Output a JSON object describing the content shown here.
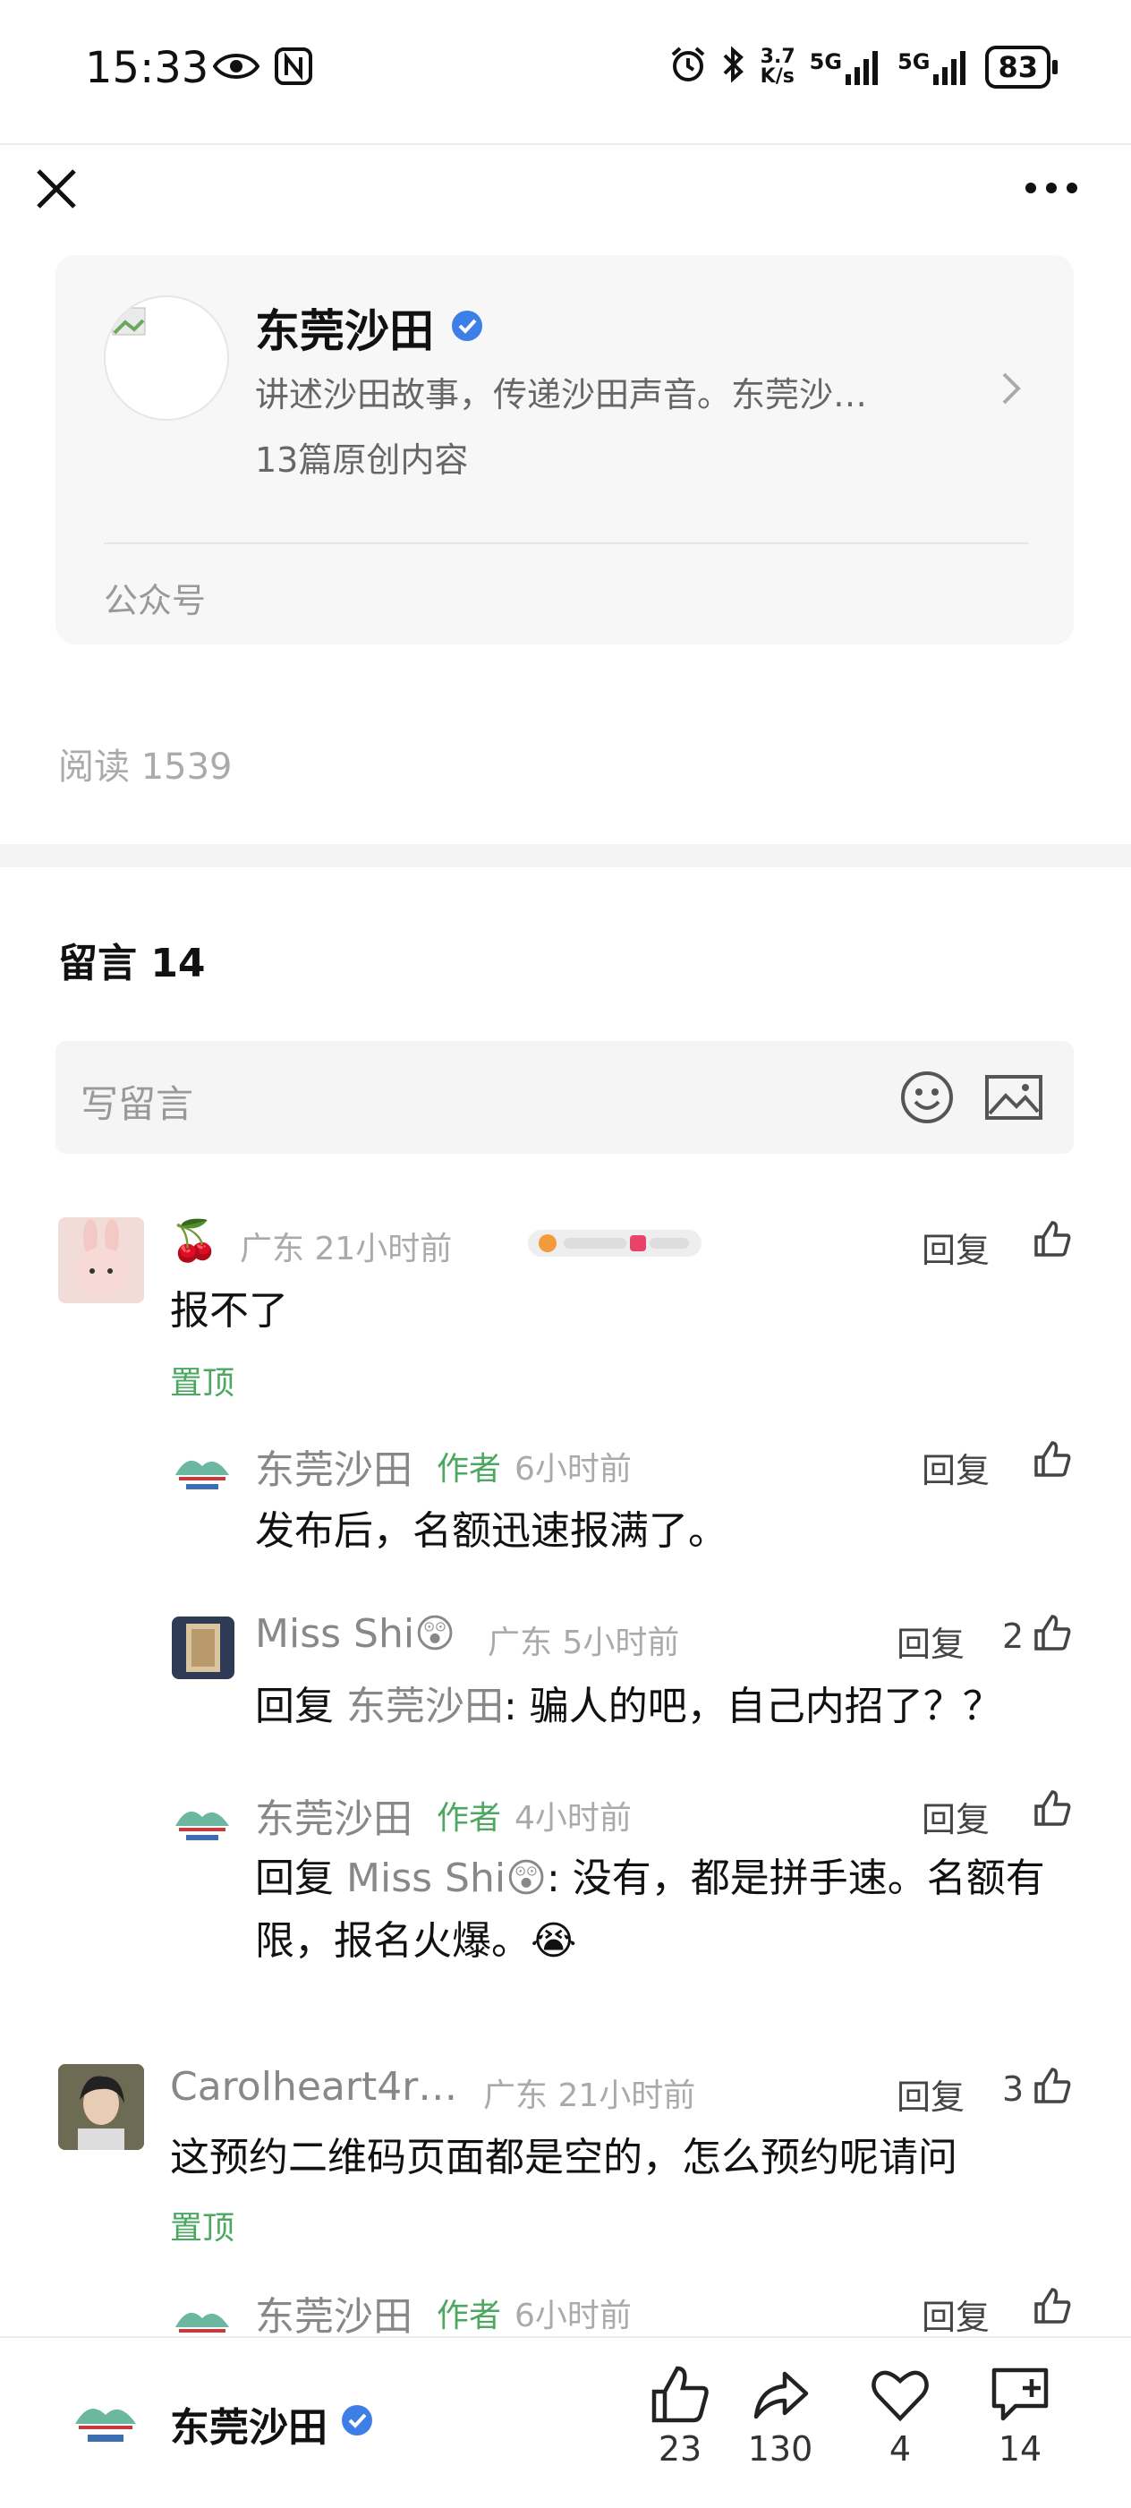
{
  "status_bar": {
    "time": "15:33",
    "net_speed_top": "3.7",
    "net_speed_bottom": "K/s",
    "sim1": "5G",
    "sim2": "5G",
    "battery": "83"
  },
  "nav": {
    "close_icon": "close-icon",
    "more_icon": "more-icon"
  },
  "account_card": {
    "name": "东莞沙田",
    "description": "讲述沙田故事，传递沙田声音。东莞沙…",
    "original_count": "13篇原创内容",
    "type_label": "公众号"
  },
  "article": {
    "read_count": "阅读 1539"
  },
  "comments": {
    "title": "留言 14",
    "write_placeholder": "写留言",
    "items": [
      {
        "user": "🍒",
        "location_time": "广东 21小时前",
        "reply": "回复",
        "text": "报不了",
        "pinned": "置顶",
        "replies": [
          {
            "user": "东莞沙田",
            "author_tag": "作者",
            "time": "6小时前",
            "reply": "回复",
            "text": "发布后，名额迅速报满了。"
          },
          {
            "user": "Miss Shi😲",
            "time": "广东 5小时前",
            "reply": "回复",
            "likes": "2",
            "prefix": "回复",
            "target": "东莞沙田",
            "text": ": 骗人的吧，自己内招了？？"
          },
          {
            "user": "东莞沙田",
            "author_tag": "作者",
            "time": "4小时前",
            "reply": "回复",
            "prefix": "回复",
            "target": "Miss Shi😲",
            "text": ": 没有，都是拼手速。名额有限，报名火爆。😭"
          }
        ]
      },
      {
        "user": "Carolheart4r…",
        "location_time": "广东 21小时前",
        "reply": "回复",
        "likes": "3",
        "text": "这预约二维码页面都是空的，怎么预约呢请问",
        "pinned": "置顶",
        "replies": [
          {
            "user": "东莞沙田",
            "author_tag": "作者",
            "time": "6小时前",
            "reply": "回复"
          }
        ]
      }
    ]
  },
  "bottom_bar": {
    "name": "东莞沙田",
    "like_count": "23",
    "share_count": "130",
    "favorite_count": "4",
    "comment_count": "14"
  }
}
